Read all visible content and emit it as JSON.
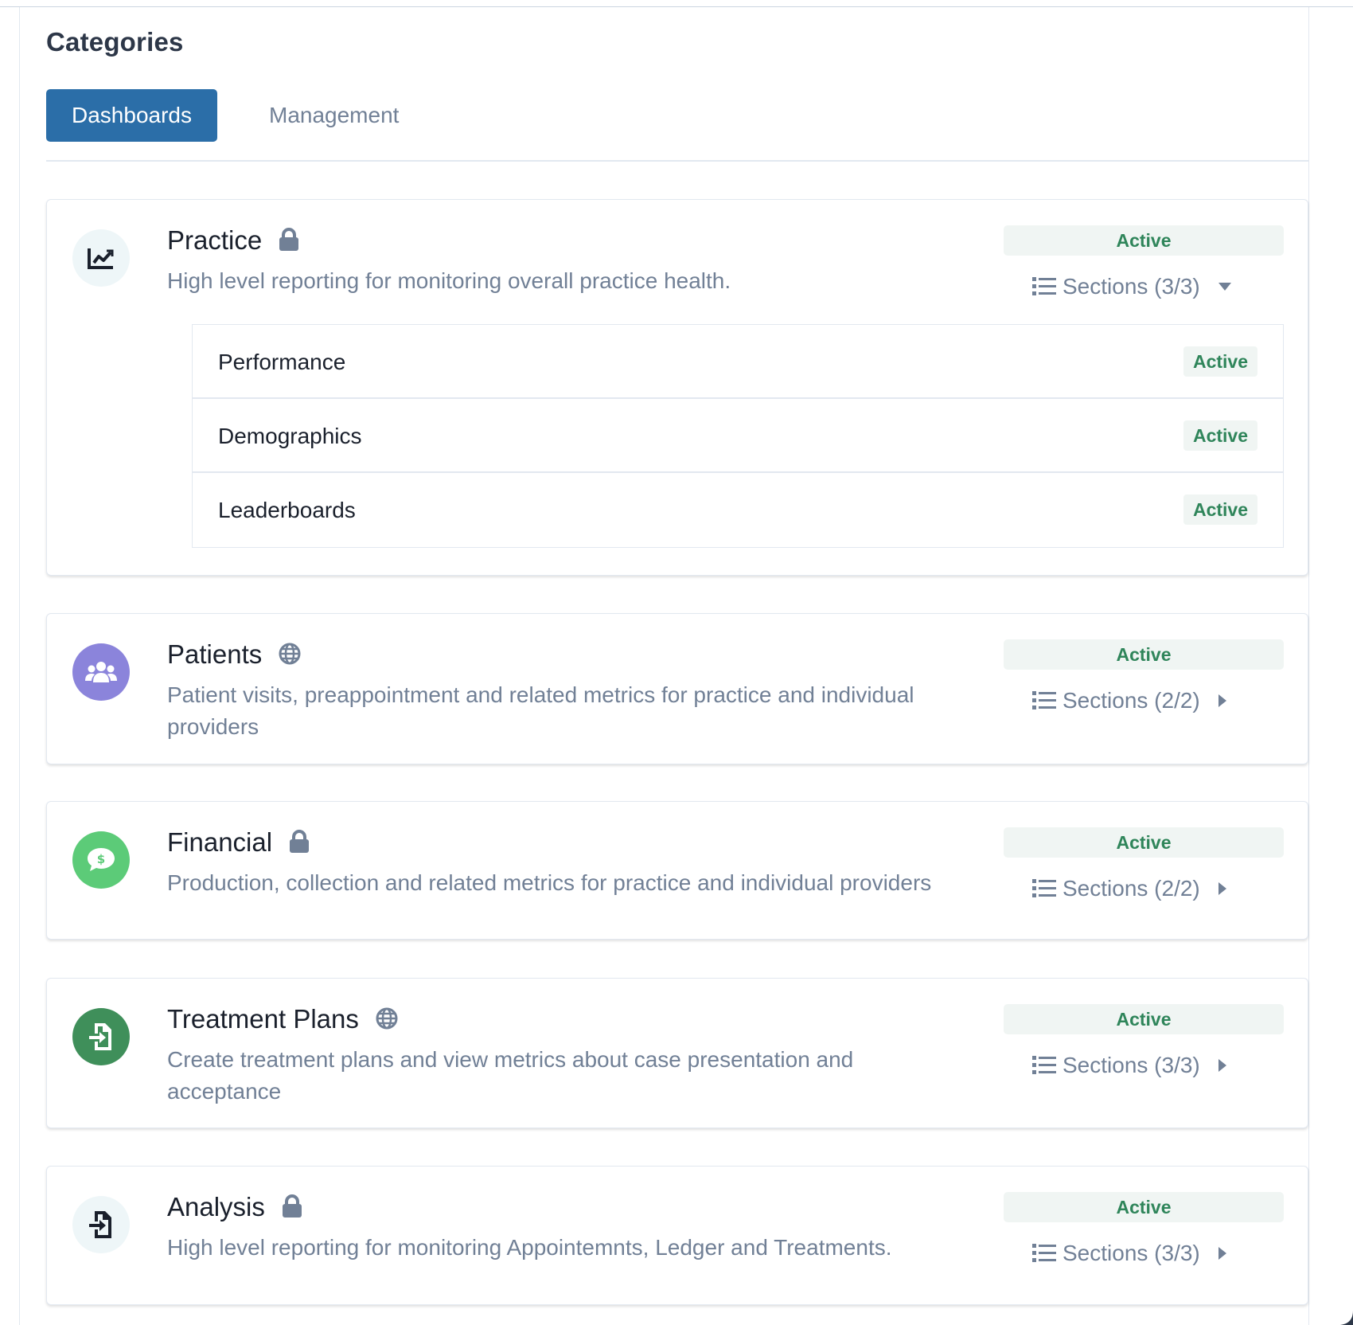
{
  "page": {
    "title": "Categories"
  },
  "tabs": [
    {
      "label": "Dashboards",
      "active": true
    },
    {
      "label": "Management",
      "active": false
    }
  ],
  "colors": {
    "accent": "#2b6ea8",
    "active_text": "#2f855a",
    "active_bg": "#f0f5f3"
  },
  "categories": [
    {
      "title": "Practice",
      "visibility_icon": "lock-icon",
      "icon": "chart-line-icon",
      "description": "High level reporting for monitoring overall practice health.",
      "status": "Active",
      "sections_label": "Sections (3/3)",
      "expanded": true,
      "sections": [
        {
          "name": "Performance",
          "status": "Active"
        },
        {
          "name": "Demographics",
          "status": "Active"
        },
        {
          "name": "Leaderboards",
          "status": "Active"
        }
      ]
    },
    {
      "title": "Patients",
      "visibility_icon": "globe-icon",
      "icon": "users-icon",
      "description": "Patient visits, preappointment and related metrics for practice and individual providers",
      "status": "Active",
      "sections_label": "Sections (2/2)",
      "expanded": false
    },
    {
      "title": "Financial",
      "visibility_icon": "lock-icon",
      "icon": "money-chat-icon",
      "description": "Production, collection and related metrics for practice and individual providers",
      "status": "Active",
      "sections_label": "Sections (2/2)",
      "expanded": false
    },
    {
      "title": "Treatment Plans",
      "visibility_icon": "globe-icon",
      "icon": "file-import-icon",
      "description": "Create treatment plans and view metrics about case presentation and acceptance",
      "status": "Active",
      "sections_label": "Sections (3/3)",
      "expanded": false
    },
    {
      "title": "Analysis",
      "visibility_icon": "lock-icon",
      "icon": "file-import-icon",
      "description": "High level reporting for monitoring Appointemnts, Ledger and Treatments.",
      "status": "Active",
      "sections_label": "Sections (3/3)",
      "expanded": false
    }
  ]
}
